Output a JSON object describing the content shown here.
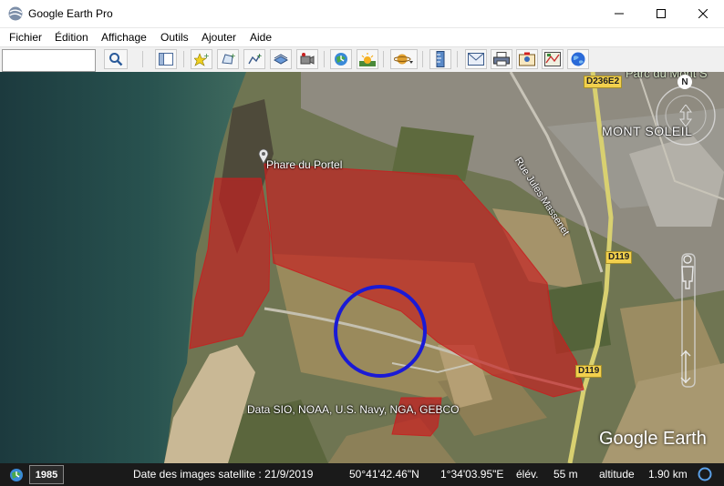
{
  "window": {
    "title": "Google Earth Pro"
  },
  "menu": [
    "Fichier",
    "Édition",
    "Affichage",
    "Outils",
    "Ajouter",
    "Aide"
  ],
  "toolbar": {
    "search_value": "",
    "icons": [
      "search-icon",
      "sidebar-icon",
      "add-placemark-icon",
      "add-polygon-icon",
      "add-path-icon",
      "add-image-overlay-icon",
      "record-tour-icon",
      "historical-imagery-icon",
      "sunlight-icon",
      "planets-icon",
      "ruler-icon",
      "email-icon",
      "print-icon",
      "save-image-icon",
      "view-in-maps-icon",
      "earth-icon"
    ]
  },
  "map": {
    "placemark": "Phare du Portel",
    "place_labels": [
      "Parc du Mont S",
      "MONT SOLEIL",
      "Rue Jules Massenet"
    ],
    "road_badges": [
      "D236E2",
      "D119",
      "D119"
    ],
    "compass": "N",
    "attribution": "Data SIO, NOAA, U.S. Navy, NGA, GEBCO",
    "logo": "Google Earth",
    "overlay_color": "#c62020",
    "circle_color": "#1a1ad6"
  },
  "status": {
    "year": "1985",
    "imagery_date": "Date des images satellite : 21/9/2019",
    "lat": "50°41'42.46\"N",
    "lon": "1°34'03.95\"E",
    "elev_label": "élév.",
    "elev_value": "55 m",
    "alt_label": "altitude",
    "alt_value": "1.90 km"
  }
}
